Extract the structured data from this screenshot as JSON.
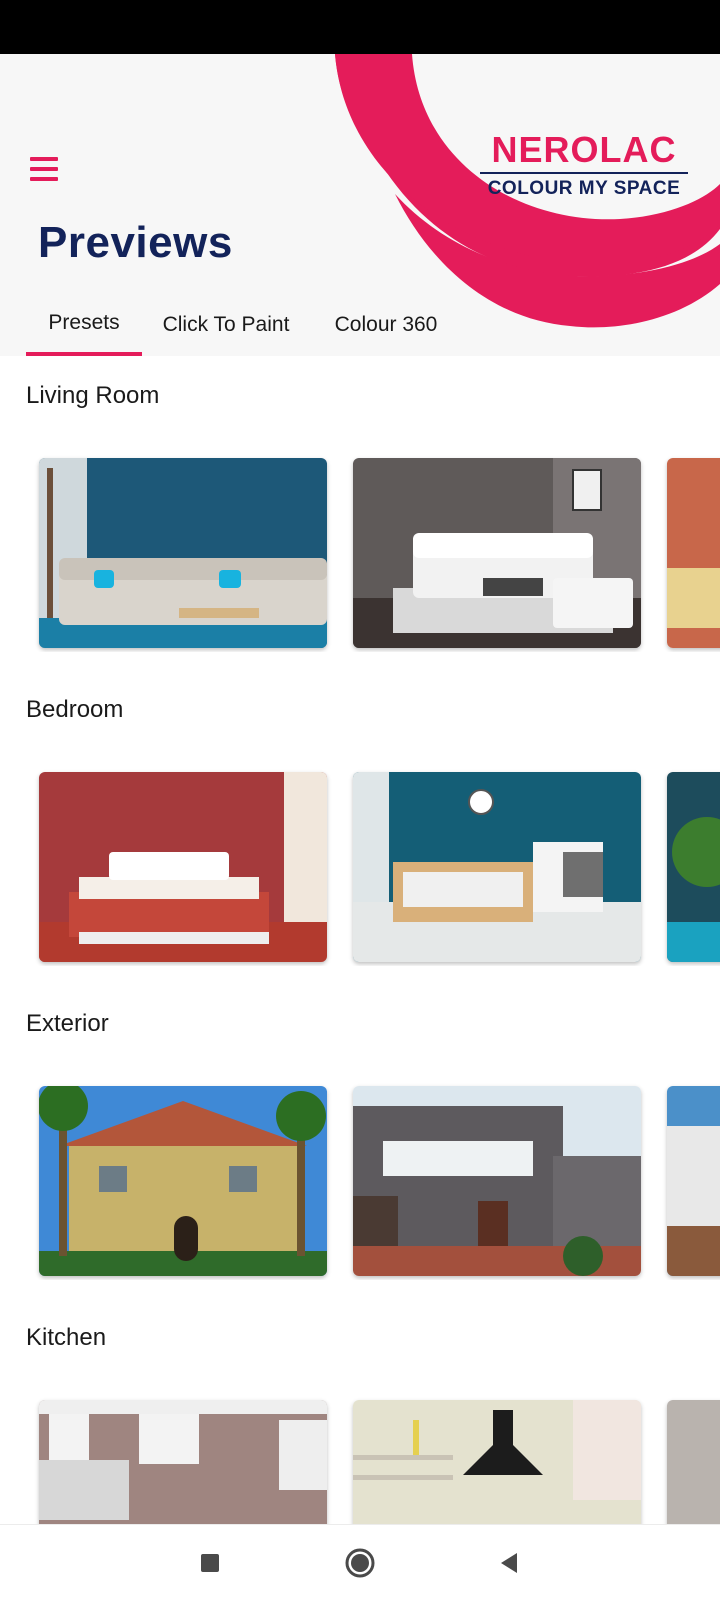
{
  "header": {
    "title": "Previews",
    "menu_icon": "hamburger-menu-icon",
    "brand": {
      "name": "NEROLAC",
      "tagline": "COLOUR MY SPACE"
    }
  },
  "tabs": [
    {
      "label": "Presets",
      "selected": true
    },
    {
      "label": "Click To Paint",
      "selected": false
    },
    {
      "label": "Colour 360",
      "selected": false
    }
  ],
  "sections": [
    {
      "title": "Living Room"
    },
    {
      "title": "Bedroom"
    },
    {
      "title": "Exterior"
    },
    {
      "title": "Kitchen"
    }
  ],
  "colors": {
    "accent": "#e41c5a",
    "brand_navy": "#13235a"
  },
  "nav_bar": {
    "recents_icon": "square-recents-icon",
    "home_icon": "circle-home-icon",
    "back_icon": "triangle-back-icon"
  }
}
